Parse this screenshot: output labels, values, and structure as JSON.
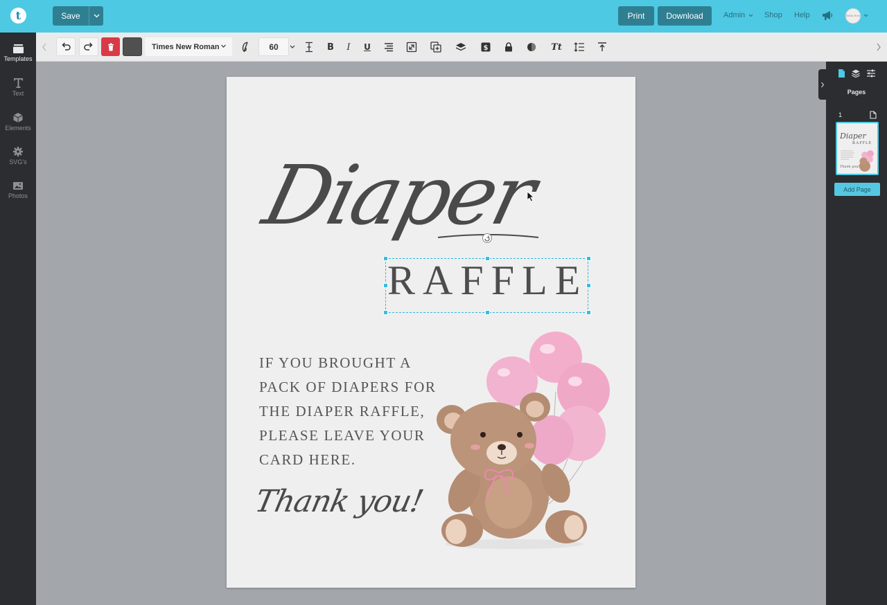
{
  "topbar": {
    "logo_letter": "t",
    "save_label": "Save",
    "print_label": "Print",
    "download_label": "Download",
    "nav": {
      "admin": "Admin",
      "shop": "Shop",
      "help": "Help"
    },
    "avatar_text": "Bella Event",
    "accent_color": "#4ec9e3"
  },
  "sidebar": {
    "items": [
      {
        "label": "Templates",
        "icon": "templates-icon"
      },
      {
        "label": "Text",
        "icon": "text-icon"
      },
      {
        "label": "Elements",
        "icon": "elements-icon"
      },
      {
        "label": "SVG's",
        "icon": "svg-icon"
      },
      {
        "label": "Photos",
        "icon": "photos-icon"
      }
    ]
  },
  "toolbar": {
    "font_family": "Times New Roman",
    "font_size": "60",
    "text_color": "#505050",
    "italic_label": "I",
    "bold_label": "B",
    "underline_label": "U",
    "case_label": "Tt"
  },
  "canvas": {
    "script_title": "Diaper",
    "title": "RAFFLE",
    "body_lines": [
      "IF YOU BROUGHT A",
      "PACK OF DIAPERS FOR",
      "THE DIAPER RAFFLE,",
      "PLEASE LEAVE YOUR",
      "CARD HERE."
    ],
    "signoff": "Thank you!"
  },
  "right_panel": {
    "title": "Pages",
    "page_number": "1",
    "add_page_label": "Add Page"
  }
}
